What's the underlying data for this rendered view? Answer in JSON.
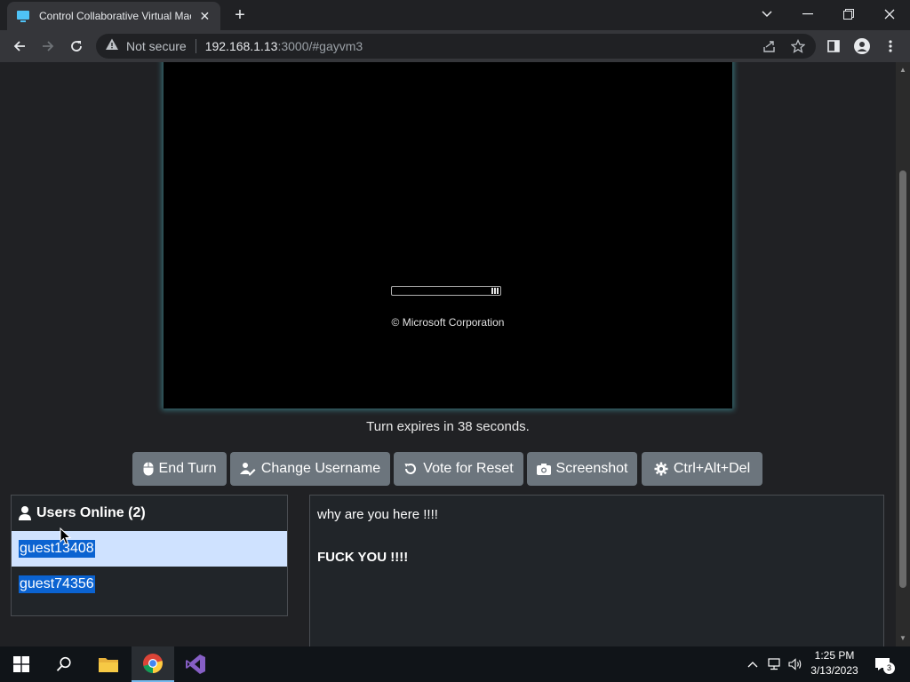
{
  "browser": {
    "tab_title": "Control Collaborative Virtual Machine",
    "address": {
      "security_label": "Not secure",
      "host": "192.168.1.13",
      "rest": ":3000/#gayvm3"
    }
  },
  "vm": {
    "copyright": "© Microsoft Corporation",
    "progress_fraction": 0.07
  },
  "turn": {
    "text": "Turn expires in 38 seconds."
  },
  "buttons": {
    "end_turn": "End Turn",
    "change_username": "Change Username",
    "vote_reset": "Vote for Reset",
    "screenshot": "Screenshot",
    "ctrl_alt_del": "Ctrl+Alt+Del"
  },
  "users": {
    "header": "Users Online (2)",
    "list": [
      "guest13408",
      "guest74356"
    ]
  },
  "chat": {
    "messages": [
      {
        "text": "why are you here !!!!",
        "bold": false
      },
      {
        "text": "FUCK YOU !!!!",
        "bold": true
      }
    ]
  },
  "taskbar": {
    "time": "1:25 PM",
    "date": "3/13/2023",
    "notification_count": "3"
  },
  "colors": {
    "button": "#6c757d",
    "selection": "#0b63d1",
    "active_row": "#cfe2ff",
    "vm_glow": "#50c8d2"
  }
}
